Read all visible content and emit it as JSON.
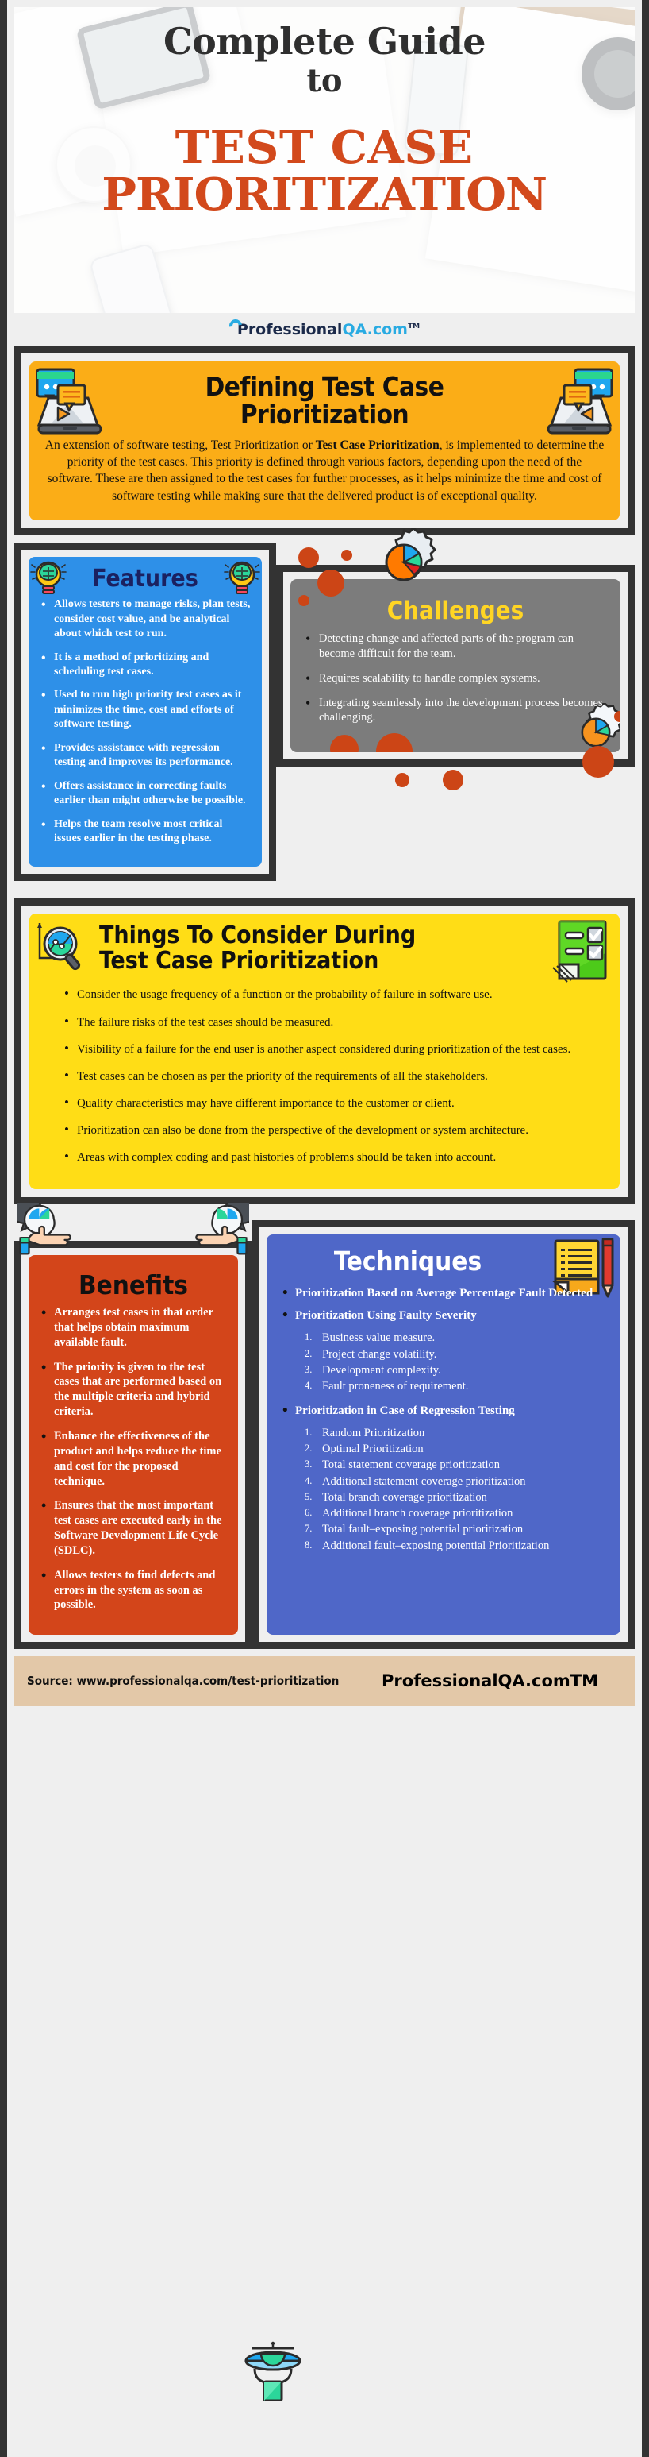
{
  "hero": {
    "line1": "Complete Guide",
    "line2": "to",
    "title_line1": "TEST CASE",
    "title_line2": "PRIORITIZATION"
  },
  "brand": {
    "name_dark": "Professional",
    "name_blue": "QA.com",
    "tm": "TM"
  },
  "defining": {
    "title_line1": "Defining Test Case",
    "title_line2": "Prioritization",
    "body_pre": "An extension of software testing, Test Prioritization or ",
    "body_bold": "Test Case Prioritization",
    "body_post": ", is implemented to determine the priority of the test cases. This priority is defined through various factors, depending upon the need of the software. These are then assigned to the test cases for further processes, as it helps minimize the time and cost of software testing while making sure that the delivered product is of exceptional quality."
  },
  "features": {
    "title": "Features",
    "items": [
      "Allows testers to manage risks, plan tests, consider cost value, and be analytical about which test to run.",
      "It is a method of prioritizing and scheduling test cases.",
      "Used to run high priority test cases as it minimizes the time, cost and efforts of software testing.",
      "Provides assistance with regression testing and improves its performance.",
      "Offers assistance in correcting faults earlier than might otherwise be possible.",
      "Helps the team resolve most critical issues earlier in the testing phase."
    ]
  },
  "challenges": {
    "title": "Challenges",
    "items": [
      "Detecting change and affected parts of the program can become difficult for the team.",
      "Requires scalability to handle complex systems.",
      "Integrating seamlessly into the development process becomes challenging."
    ]
  },
  "consider": {
    "title_line1": "Things To Consider During",
    "title_line2": "Test Case Prioritization",
    "items": [
      "Consider the usage frequency of a function or the probability of failure in software use.",
      "The failure risks of the test cases should be measured.",
      "Visibility of a failure for the end user is another aspect considered during prioritization of the test cases.",
      "Test cases can be chosen as per the priority of the requirements of all the stakeholders.",
      "Quality characteristics may have different importance to the customer or client.",
      "Prioritization can also be done from the perspective of the development or system architecture.",
      "Areas with complex coding and past histories of problems should be taken into account."
    ]
  },
  "benefits": {
    "title": "Benefits",
    "items": [
      "Arranges test cases in that order that helps obtain maximum available fault.",
      "The priority is given to the test cases that are performed based on the multiple criteria and hybrid criteria.",
      "Enhance the effectiveness of the product and helps reduce the time and cost for the proposed technique.",
      "Ensures that the most important test cases are executed early in the Software Development Life Cycle (SDLC).",
      "Allows testers to find defects and errors in the system as soon as possible."
    ]
  },
  "techniques": {
    "title": "Techniques",
    "bullet1": "Prioritization Based on Average Percentage Fault Detected",
    "bullet2": "Prioritization Using Faulty Severity",
    "sub1": [
      "Business value measure.",
      "Project change volatility.",
      "Development complexity.",
      "Fault proneness of requirement."
    ],
    "bullet3": "Prioritization in Case of Regression Testing",
    "sub2": [
      "Random Prioritization",
      "Optimal Prioritization",
      "Total statement coverage prioritization",
      "Additional statement coverage prioritization",
      "Total branch coverage prioritization",
      "Additional branch coverage prioritization",
      "Total fault–exposing potential prioritization",
      "Additional fault–exposing potential Prioritization"
    ]
  },
  "footer": {
    "source": "Source: www.professionalqa.com/test-prioritization"
  },
  "colors": {
    "orange_panel": "#FBAD17",
    "blue_panel": "#2E90E8",
    "gray_panel": "#7C7C7C",
    "yellow_panel": "#FFDD16",
    "red_panel": "#D3451A",
    "indigo_panel": "#4F67C8",
    "hero_accent": "#D2491C",
    "frame": "#333333",
    "page_bg": "#EFEFEF",
    "footer_bg": "#E3C8A8",
    "brand_blue": "#29ABE2",
    "brand_dark": "#1B2A4A",
    "challenges_title": "#FFD524",
    "features_title": "#1B2160",
    "dot": "#CC4516"
  }
}
